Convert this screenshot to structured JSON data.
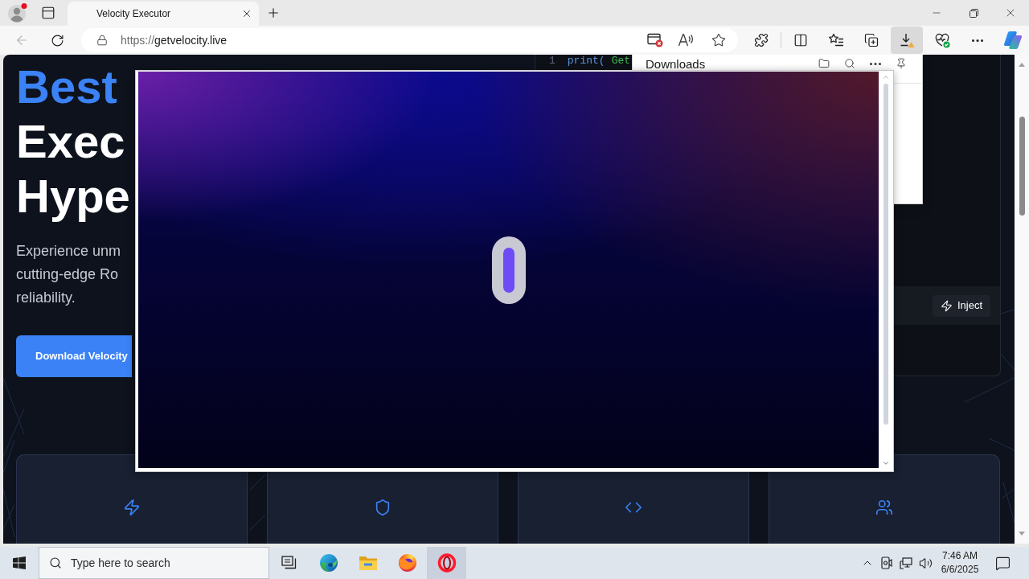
{
  "browser": {
    "tabs": [
      {
        "title": "Velocity Executor",
        "selected": true
      }
    ],
    "address": {
      "scheme": "https://",
      "host": "getvelocity.live"
    },
    "toolbar_buttons": [
      {
        "kind": "extensions",
        "selected": false
      },
      {
        "kind": "split_screen",
        "selected": false
      },
      {
        "kind": "favorites",
        "selected": false
      },
      {
        "kind": "collections",
        "selected": false
      },
      {
        "kind": "downloads",
        "selected": true
      },
      {
        "kind": "essentials",
        "selected": false
      },
      {
        "kind": "more",
        "selected": false
      },
      {
        "kind": "copilot",
        "selected": false
      }
    ]
  },
  "page": {
    "hero": {
      "title_lines": [
        {
          "text": "Best",
          "accent": true
        },
        {
          "text": "Exec",
          "accent": false
        },
        {
          "text": "Hype",
          "accent": false
        }
      ],
      "description_lines": [
        "Experience unm",
        "cutting-edge Ro",
        "reliability."
      ],
      "download_button": "Download Velocity"
    },
    "editor": {
      "line_number": "1",
      "code_tokens": [
        {
          "text": "print(",
          "kind": "function"
        },
        {
          "text": "Get",
          "kind": "string"
        }
      ],
      "inject_button": "Inject"
    },
    "features": [
      {
        "kind": "lightning"
      },
      {
        "kind": "shield"
      },
      {
        "kind": "code"
      },
      {
        "kind": "users"
      }
    ]
  },
  "downloads_panel": {
    "title": "Downloads"
  },
  "taskbar": {
    "search_placeholder": "Type here to search",
    "apps": [
      {
        "kind": "task_view",
        "selected": false
      },
      {
        "kind": "edge",
        "selected": false
      },
      {
        "kind": "file_explorer",
        "selected": false
      },
      {
        "kind": "firefox",
        "selected": false
      },
      {
        "kind": "opera",
        "selected": true
      }
    ],
    "time": "7:46 AM",
    "date": "6/6/2025"
  }
}
